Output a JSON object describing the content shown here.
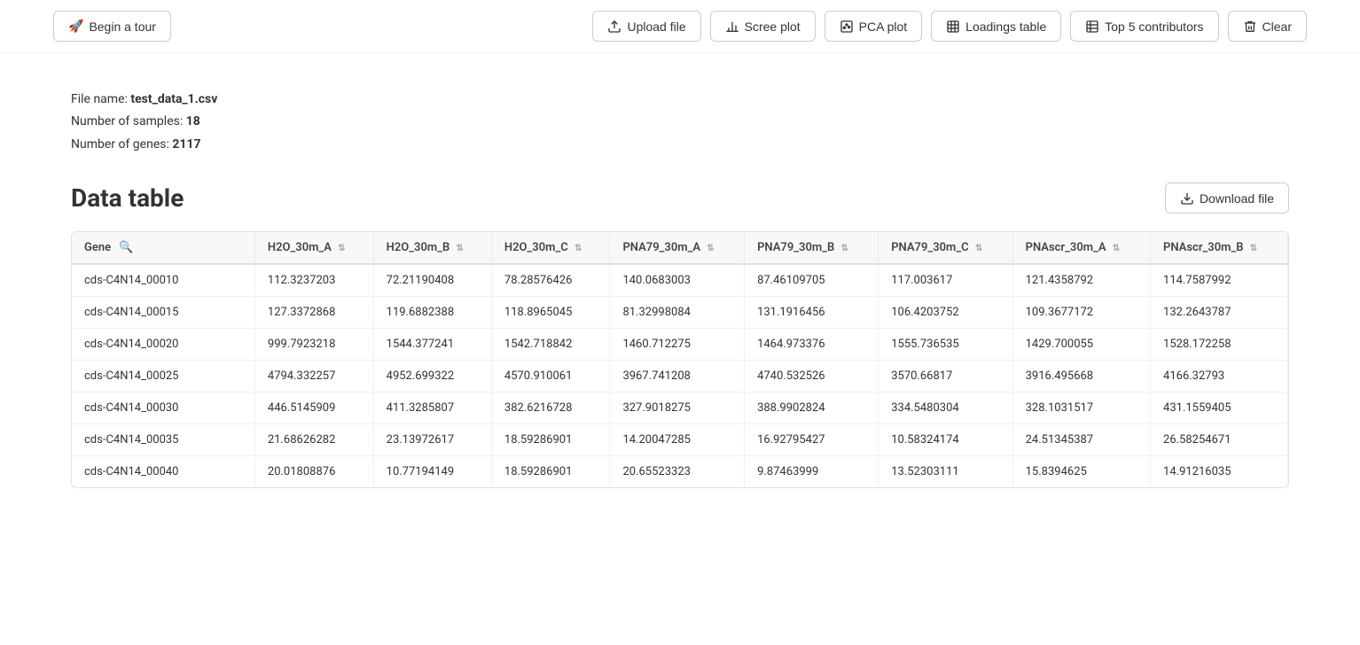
{
  "toolbar": {
    "begin_tour_label": "Begin a tour",
    "upload_file_label": "Upload file",
    "scree_plot_label": "Scree plot",
    "pca_plot_label": "PCA plot",
    "loadings_table_label": "Loadings table",
    "top5_label": "Top 5 contributors",
    "clear_label": "Clear"
  },
  "file_info": {
    "label_name": "File name:",
    "file_name": "test_data_1.csv",
    "label_samples": "Number of samples:",
    "samples_count": "18",
    "label_genes": "Number of genes:",
    "genes_count": "2117"
  },
  "data_table": {
    "title": "Data table",
    "download_label": "Download file",
    "columns": [
      "Gene",
      "H2O_30m_A",
      "H2O_30m_B",
      "H2O_30m_C",
      "PNA79_30m_A",
      "PNA79_30m_B",
      "PNA79_30m_C",
      "PNAscr_30m_A",
      "PNAscr_30m_B"
    ],
    "rows": [
      [
        "cds-C4N14_00010",
        "112.3237203",
        "72.21190408",
        "78.28576426",
        "140.0683003",
        "87.46109705",
        "117.003617",
        "121.4358792",
        "114.7587992"
      ],
      [
        "cds-C4N14_00015",
        "127.3372868",
        "119.6882388",
        "118.8965045",
        "81.32998084",
        "131.1916456",
        "106.4203752",
        "109.3677172",
        "132.2643787"
      ],
      [
        "cds-C4N14_00020",
        "999.7923218",
        "1544.377241",
        "1542.718842",
        "1460.712275",
        "1464.973376",
        "1555.736535",
        "1429.700055",
        "1528.172258"
      ],
      [
        "cds-C4N14_00025",
        "4794.332257",
        "4952.699322",
        "4570.910061",
        "3967.741208",
        "4740.532526",
        "3570.66817",
        "3916.495668",
        "4166.32793"
      ],
      [
        "cds-C4N14_00030",
        "446.5145909",
        "411.3285807",
        "382.6216728",
        "327.9018275",
        "388.9902824",
        "334.5480304",
        "328.1031517",
        "431.1559405"
      ],
      [
        "cds-C4N14_00035",
        "21.68626282",
        "23.13972617",
        "18.59286901",
        "14.20047285",
        "16.92795427",
        "10.58324174",
        "24.51345387",
        "26.58254671"
      ],
      [
        "cds-C4N14_00040",
        "20.01808876",
        "10.77194149",
        "18.59286901",
        "20.65523323",
        "9.87463999",
        "13.52303111",
        "15.8394625",
        "14.91216035"
      ]
    ]
  }
}
